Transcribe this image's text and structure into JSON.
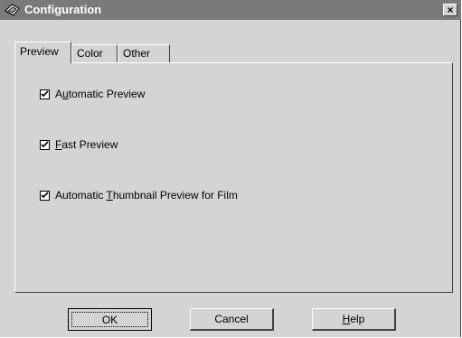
{
  "window": {
    "title": "Configuration",
    "close_glyph": "×"
  },
  "tabs": [
    {
      "label": "Preview",
      "active": true
    },
    {
      "label": "Color",
      "active": false
    },
    {
      "label": "Other",
      "active": false
    }
  ],
  "options": [
    {
      "pre": "A",
      "mnemonic": "u",
      "post": "tomatic Preview",
      "checked": true
    },
    {
      "pre": "",
      "mnemonic": "F",
      "post": "ast Preview",
      "checked": true
    },
    {
      "pre": "Automatic ",
      "mnemonic": "T",
      "post": "humbnail Preview for Film",
      "checked": true
    }
  ],
  "buttons": {
    "ok": "OK",
    "cancel": "Cancel",
    "help_mnemonic": "H",
    "help_rest": "elp"
  },
  "icons": {
    "app": "scanner-app-icon",
    "close": "close-icon",
    "check": "checkmark-icon"
  }
}
